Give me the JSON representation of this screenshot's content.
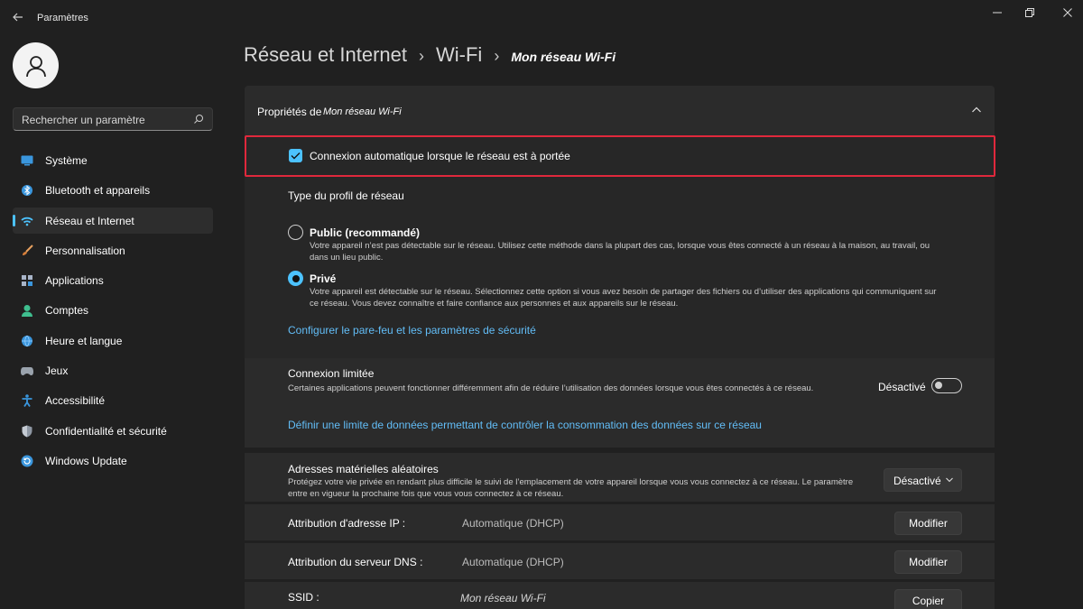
{
  "window": {
    "title": "Paramètres"
  },
  "sidebar": {
    "search_placeholder": "Rechercher un paramètre",
    "items": [
      {
        "label": "Système",
        "icon": "monitor-icon"
      },
      {
        "label": "Bluetooth et appareils",
        "icon": "bluetooth-icon"
      },
      {
        "label": "Réseau et Internet",
        "icon": "wifi-icon",
        "active": true
      },
      {
        "label": "Personnalisation",
        "icon": "brush-icon"
      },
      {
        "label": "Applications",
        "icon": "apps-icon"
      },
      {
        "label": "Comptes",
        "icon": "person-icon"
      },
      {
        "label": "Heure et langue",
        "icon": "globe-clock-icon"
      },
      {
        "label": "Jeux",
        "icon": "gamepad-icon"
      },
      {
        "label": "Accessibilité",
        "icon": "accessibility-icon"
      },
      {
        "label": "Confidentialité et sécurité",
        "icon": "shield-icon"
      },
      {
        "label": "Windows Update",
        "icon": "update-icon"
      }
    ]
  },
  "breadcrumb": {
    "level1": "Réseau et Internet",
    "level2": "Wi-Fi",
    "level3": "Mon réseau Wi-Fi",
    "separator": "›"
  },
  "properties": {
    "header_label": "Propriétés de",
    "network_name": "Mon réseau Wi-Fi",
    "auto_connect_label": "Connexion automatique lorsque le réseau est à portée",
    "auto_connect_checked": true,
    "profile_type_title": "Type du profil de réseau",
    "public_title": "Public (recommandé)",
    "public_desc": "Votre appareil n’est pas détectable sur le réseau. Utilisez cette méthode dans la plupart des cas, lorsque vous êtes connecté à un réseau à la maison, au travail, ou dans un lieu public.",
    "private_title": "Privé",
    "private_desc": "Votre appareil est détectable sur le réseau. Sélectionnez cette option si vous avez besoin de partager des fichiers ou d’utiliser des applications qui communiquent sur ce réseau. Vous devez connaître et faire confiance aux personnes et aux appareils sur le réseau.",
    "selected_profile": "Privé",
    "firewall_link": "Configurer le pare-feu et les paramètres de sécurité",
    "metered_title": "Connexion limitée",
    "metered_desc": "Certaines applications peuvent fonctionner différemment afin de réduire l’utilisation des données lorsque vous êtes connectés à ce réseau.",
    "metered_state": "Désactivé",
    "data_limit_link": "Définir une limite de données permettant de contrôler la consommation des données sur ce réseau",
    "random_mac_title": "Adresses matérielles aléatoires",
    "random_mac_desc": "Protégez votre vie privée en rendant plus difficile le suivi de l’emplacement de votre appareil lorsque vous vous connectez à ce réseau. Le paramètre entre en vigueur la prochaine fois que vous vous connectez à ce réseau.",
    "random_mac_value": "Désactivé",
    "ip_label": "Attribution d'adresse IP :",
    "ip_value": "Automatique (DHCP)",
    "ip_button": "Modifier",
    "dns_label": "Attribution du serveur DNS :",
    "dns_value": "Automatique (DHCP)",
    "dns_button": "Modifier",
    "ssid_label": "SSID :",
    "ssid_value": "Mon réseau Wi-Fi",
    "ssid_button": "Copier"
  },
  "colors": {
    "accent": "#4cc2ff",
    "highlight": "#e0283c",
    "link": "#62bdf7"
  }
}
